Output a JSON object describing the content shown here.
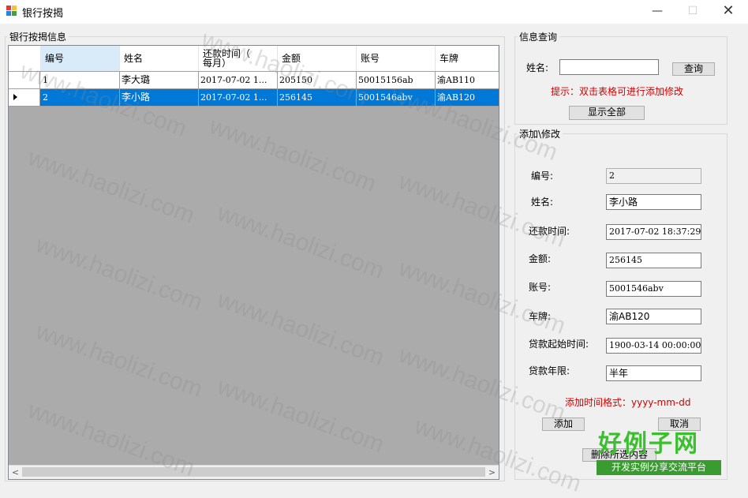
{
  "window": {
    "title": "银行按揭"
  },
  "grid": {
    "group_title": "银行按揭信息",
    "columns": [
      "编号",
      "姓名",
      "还款时间（\n每月）",
      "金额",
      "账号",
      "车牌"
    ],
    "rows": [
      [
        "1",
        "李大璐",
        "2017-07-02 1...",
        "205150",
        "50015156ab",
        "渝AB110"
      ],
      [
        "2",
        "李小路",
        "2017-07-02 1...",
        "256145",
        "5001546abv",
        "渝AB120"
      ]
    ],
    "selected_row": 2
  },
  "query": {
    "group_title": "信息查询",
    "name_label": "姓名:",
    "name_value": "",
    "search_button": "查询",
    "hint": "提示：双击表格可进行添加修改",
    "show_all_button": "显示全部"
  },
  "edit": {
    "group_title": "添加\\修改",
    "fields": [
      {
        "label": "编号:",
        "value": "2"
      },
      {
        "label": "姓名:",
        "value": "李小路"
      },
      {
        "label": "还款时间:",
        "value": "2017-07-02 18:37:29"
      },
      {
        "label": "金额:",
        "value": "256145"
      },
      {
        "label": "账号:",
        "value": "5001546abv"
      },
      {
        "label": "车牌:",
        "value": "渝AB120"
      },
      {
        "label": "贷款起始时间:",
        "value": "1900-03-14 00:00:00"
      },
      {
        "label": "贷款年限:",
        "value": "半年"
      }
    ],
    "format_hint": "添加时间格式：yyyy-mm-dd",
    "add_button": "添加",
    "cancel_button": "取消",
    "delete_button": "删除所选内容"
  },
  "watermark": {
    "text": "www.haolizi.com",
    "logo_main": "好例子网",
    "logo_sub": "开发实例分享交流平台"
  },
  "colors": {
    "selection": "#0078d7",
    "hint_red": "#d40000",
    "grid_bg": "#ababab",
    "logo_green": "#3cbf2f"
  }
}
